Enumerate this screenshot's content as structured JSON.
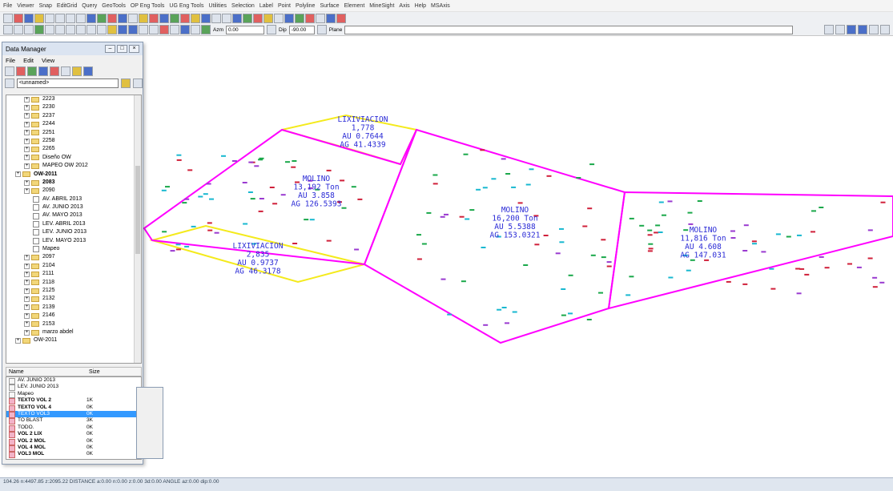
{
  "menu": [
    "File",
    "Viewer",
    "Snap",
    "EditGrid",
    "Query",
    "GeoTools",
    "OP Eng Tools",
    "UG Eng Tools",
    "Utilities",
    "Selection",
    "Label",
    "Point",
    "Polyline",
    "Surface",
    "Element",
    "MineSight",
    "Axis",
    "Help",
    "MSAxis"
  ],
  "toolbar": {
    "azm_label": "Azm",
    "azm_value": "0.00",
    "dip_label": "Dip",
    "dip_value": "-90.00",
    "plane_label": "Plane"
  },
  "data_manager": {
    "title": "Data Manager",
    "menu": [
      "File",
      "Edit",
      "View"
    ],
    "selector": "<unnamed>",
    "tree": [
      {
        "label": "2223",
        "type": "folder",
        "depth": 2
      },
      {
        "label": "2230",
        "type": "folder",
        "depth": 2
      },
      {
        "label": "2237",
        "type": "folder",
        "depth": 2
      },
      {
        "label": "2244",
        "type": "folder",
        "depth": 2
      },
      {
        "label": "2251",
        "type": "folder",
        "depth": 2
      },
      {
        "label": "2258",
        "type": "folder",
        "depth": 2
      },
      {
        "label": "2265",
        "type": "folder",
        "depth": 2
      },
      {
        "label": "Diseño OW",
        "type": "folder",
        "depth": 2
      },
      {
        "label": "MAPEO OW 2012",
        "type": "folder",
        "depth": 2
      },
      {
        "label": "OW-2011",
        "type": "folder",
        "depth": 1,
        "bold": true
      },
      {
        "label": "2083",
        "type": "folder",
        "depth": 2,
        "bold": true
      },
      {
        "label": "2090",
        "type": "folder",
        "depth": 2
      },
      {
        "label": "AV. ABRIL 2013",
        "type": "doc",
        "depth": 3
      },
      {
        "label": "AV. JUNIO 2013",
        "type": "doc",
        "depth": 3
      },
      {
        "label": "AV. MAYO 2013",
        "type": "doc",
        "depth": 3
      },
      {
        "label": "LEV. ABRIL 2013",
        "type": "doc",
        "depth": 3
      },
      {
        "label": "LEV. JUNIO 2013",
        "type": "doc",
        "depth": 3
      },
      {
        "label": "LEV. MAYO 2013",
        "type": "doc",
        "depth": 3
      },
      {
        "label": "Mapeo",
        "type": "doc",
        "depth": 3
      },
      {
        "label": "2097",
        "type": "folder",
        "depth": 2
      },
      {
        "label": "2104",
        "type": "folder",
        "depth": 2
      },
      {
        "label": "2111",
        "type": "folder",
        "depth": 2
      },
      {
        "label": "2118",
        "type": "folder",
        "depth": 2
      },
      {
        "label": "2125",
        "type": "folder",
        "depth": 2
      },
      {
        "label": "2132",
        "type": "folder",
        "depth": 2
      },
      {
        "label": "2139",
        "type": "folder",
        "depth": 2
      },
      {
        "label": "2146",
        "type": "folder",
        "depth": 2
      },
      {
        "label": "2153",
        "type": "folder",
        "depth": 2
      },
      {
        "label": "marzo abdel",
        "type": "folder",
        "depth": 2
      },
      {
        "label": "OW-2011",
        "type": "folder",
        "depth": 1
      }
    ],
    "list_headers": {
      "name": "Name",
      "size": "Size"
    },
    "list": [
      {
        "name": "AV. JUNIO 2013",
        "size": "",
        "type": "doc"
      },
      {
        "name": "LEV. JUNIO 2013",
        "size": "",
        "type": "doc"
      },
      {
        "name": "Mapeo",
        "size": "",
        "type": "doc"
      },
      {
        "name": "TEXTO VOL 2",
        "size": "1K",
        "type": "txt",
        "bold": true
      },
      {
        "name": "TEXTO VOL 4",
        "size": "0K",
        "type": "txt",
        "bold": true
      },
      {
        "name": "TEXTO VOL3",
        "size": "0K",
        "type": "txt",
        "selected": true
      },
      {
        "name": "TO BLAST",
        "size": "3K",
        "type": "txt"
      },
      {
        "name": "TODO.",
        "size": "0K",
        "type": "txt"
      },
      {
        "name": "VOL 2 LIX",
        "size": "0K",
        "type": "txt",
        "bold": true
      },
      {
        "name": "VOL 2 MOL",
        "size": "0K",
        "type": "txt",
        "bold": true
      },
      {
        "name": "VOL 4 MOL",
        "size": "0K",
        "type": "txt",
        "bold": true
      },
      {
        "name": "VOL3 MOL",
        "size": "0K",
        "type": "txt",
        "bold": true
      }
    ]
  },
  "canvas": {
    "labels": [
      {
        "lines": [
          "LIXIVIACION",
          "1,778",
          "AU 0.7644",
          "AG 41.4339"
        ]
      },
      {
        "lines": [
          "MOLINO",
          "13,192 Ton",
          "AU 3.858",
          "AG 126.5393"
        ]
      },
      {
        "lines": [
          "LIXIVIACION",
          "2,835",
          "AU 0.9737",
          "AG 46.3178"
        ]
      },
      {
        "lines": [
          "MOLINO",
          "16,200 Ton",
          "AU 5.5388",
          "AG 153.0321"
        ]
      },
      {
        "lines": [
          "MOLINO",
          "11,816 Ton",
          "AU 4.608",
          "AG 147.031"
        ]
      }
    ],
    "colors": {
      "magenta": "#ff00ff",
      "yellow": "#f4ea1c",
      "label": "#2b2bd6",
      "point_red": "#d0203a",
      "point_green": "#1aa84a",
      "point_cyan": "#18b8d0",
      "point_purple": "#9a3ad0"
    }
  },
  "status": {
    "text": "104.26  n:4497.85  z:2095.22  DISTANCE  a:0.00  n:0.00  z:0.00  3d:0.00  ANGLE  az:0.00  dip:0.00"
  }
}
